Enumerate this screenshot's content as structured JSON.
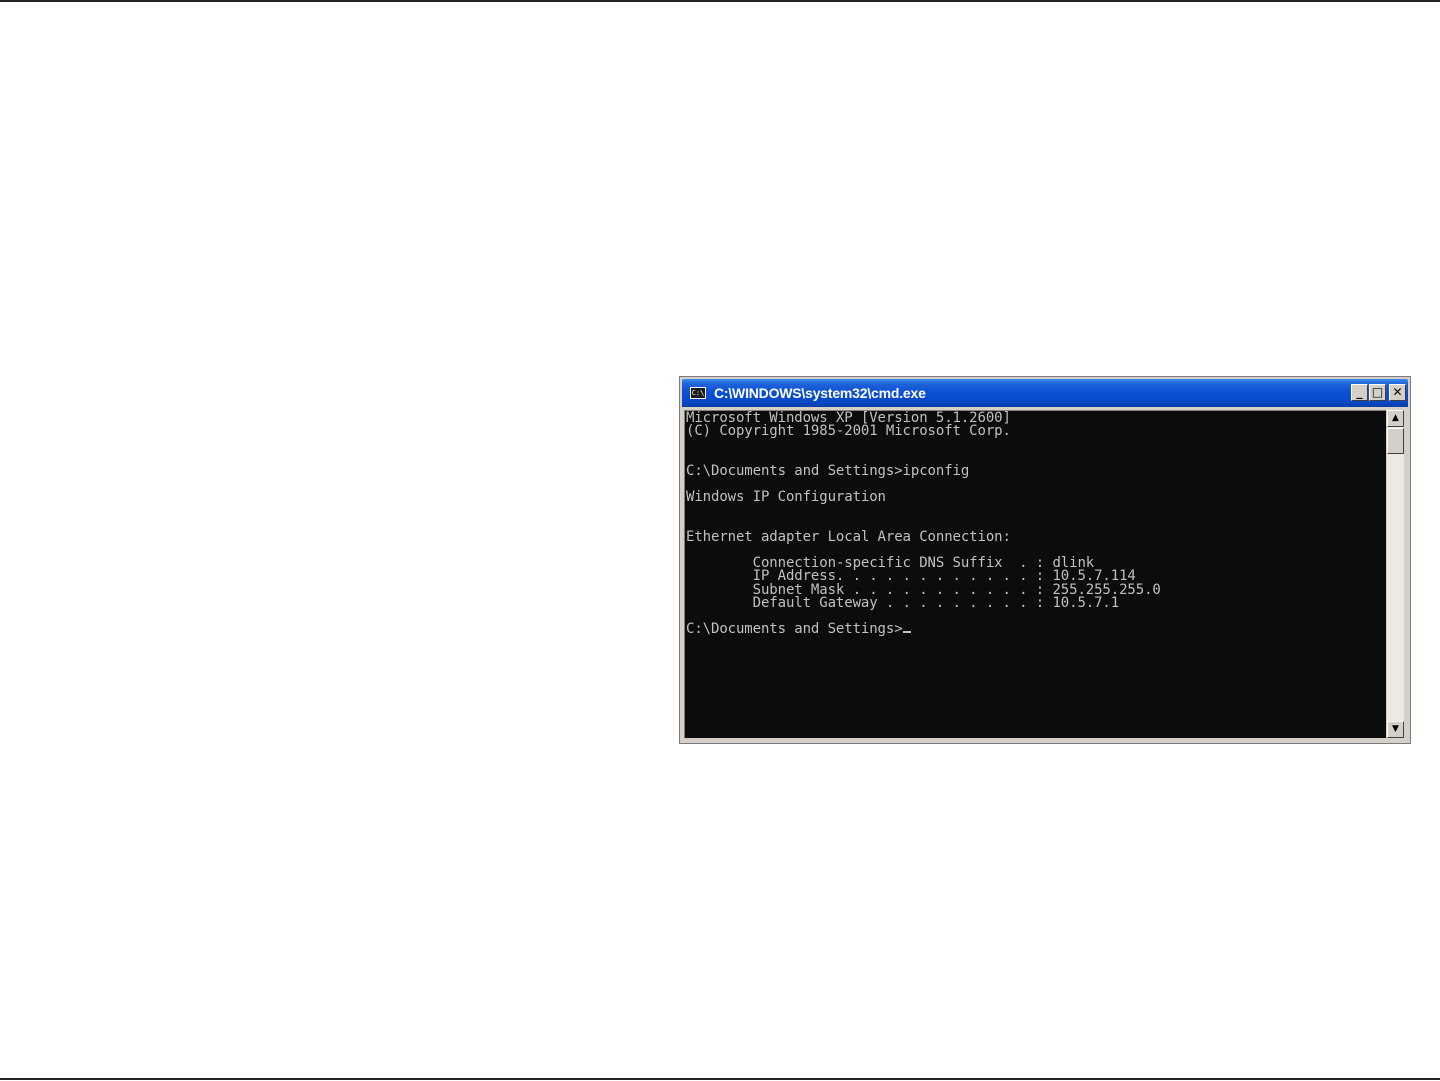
{
  "window": {
    "title": "C:\\WINDOWS\\system32\\cmd.exe",
    "icon_label": "C:\\",
    "icons": {
      "app": "cmd-console-icon",
      "minimize": "minimize-icon",
      "maximize": "maximize-icon",
      "close": "close-icon"
    },
    "buttons": {
      "minimize_glyph": "_",
      "maximize_glyph": "□",
      "close_glyph": "✕"
    }
  },
  "console": {
    "lines": [
      "Microsoft Windows XP [Version 5.1.2600]",
      "(C) Copyright 1985-2001 Microsoft Corp.",
      "",
      "",
      "C:\\Documents and Settings>ipconfig",
      "",
      "Windows IP Configuration",
      "",
      "",
      "Ethernet adapter Local Area Connection:",
      "",
      "        Connection-specific DNS Suffix  . : dlink",
      "        IP Address. . . . . . . . . . . . : 10.5.7.114",
      "        Subnet Mask . . . . . . . . . . . : 255.255.255.0",
      "        Default Gateway . . . . . . . . . : 10.5.7.1",
      "",
      "C:\\Documents and Settings>"
    ],
    "colors": {
      "background": "#0c0c0c",
      "text": "#c0c0c0"
    }
  },
  "scrollbar": {
    "up_glyph": "▲",
    "down_glyph": "▼"
  },
  "theme": {
    "titlebar_blue": "#0a4fd4",
    "frame": "#d4d0c8"
  }
}
